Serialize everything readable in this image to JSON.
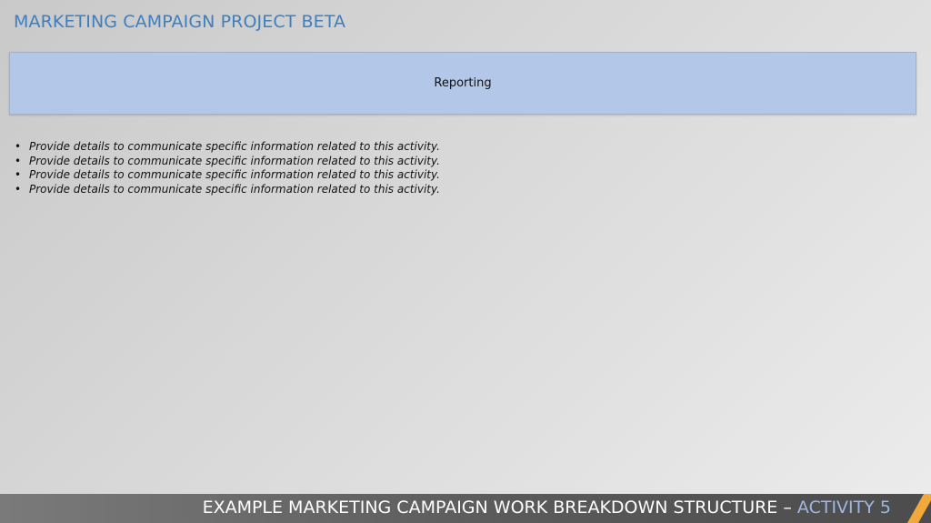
{
  "header": {
    "title": "MARKETING CAMPAIGN PROJECT BETA"
  },
  "section": {
    "label": "Reporting"
  },
  "bullets": [
    "Provide details to communicate specific information related to this activity.",
    "Provide details to communicate specific information related to this activity.",
    "Provide details to communicate specific information related to this activity.",
    "Provide details to communicate specific information related to this activity."
  ],
  "footer": {
    "title_main": "EXAMPLE MARKETING CAMPAIGN WORK BREAKDOWN STRUCTURE –",
    "title_accent": "ACTIVITY 5"
  },
  "colors": {
    "title": "#3d7fbf",
    "section_fill": "#b3c7e8",
    "footer_bg": "#5a5a5a",
    "footer_accent": "#9fb6e6",
    "stripe": "#f2a93b"
  }
}
